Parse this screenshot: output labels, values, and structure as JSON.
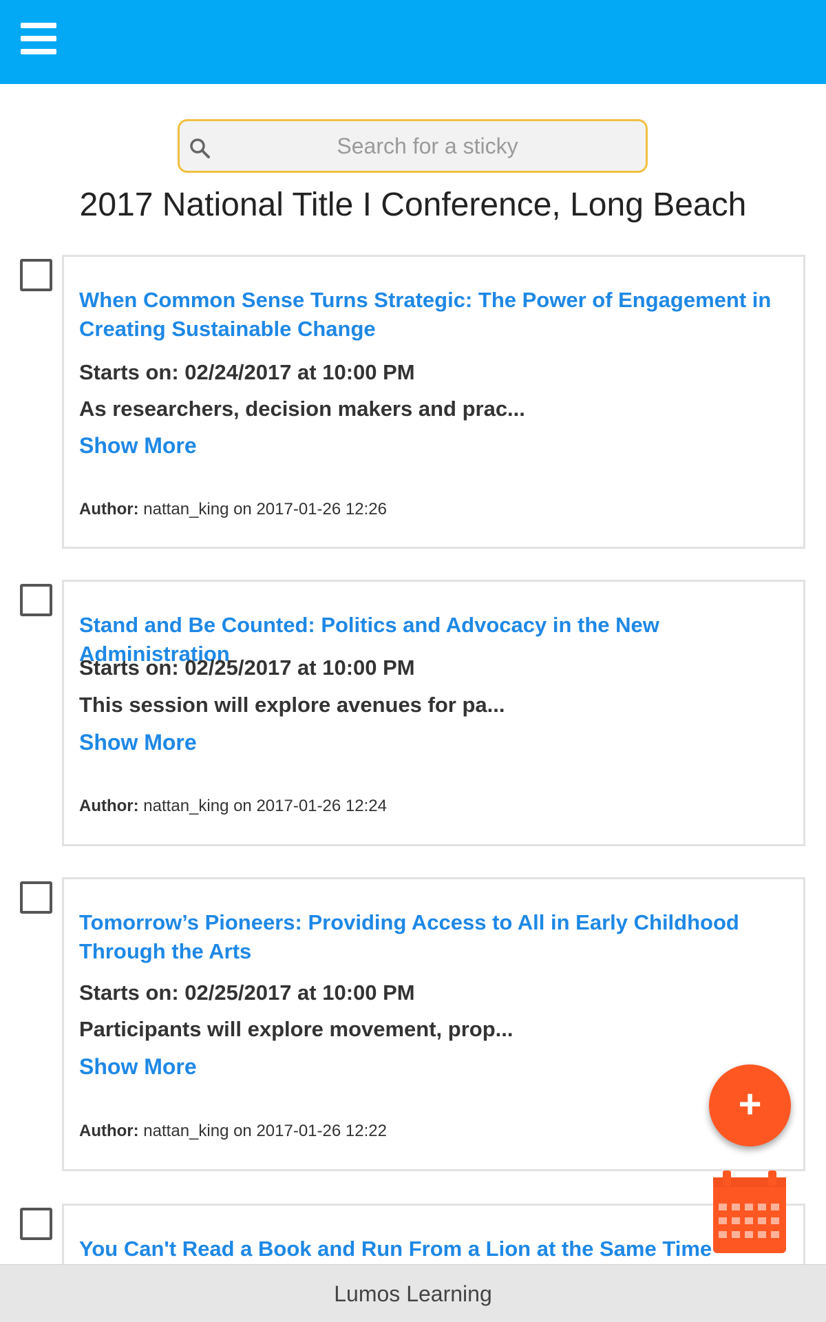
{
  "colors": {
    "app_bar": "#03a9f4",
    "link": "#1e88e5",
    "fab": "#ff5722",
    "search_border": "#f0c040"
  },
  "header": {
    "menu_icon": "hamburger-menu-icon"
  },
  "search": {
    "placeholder": "Search for a sticky",
    "value": ""
  },
  "page_title": "2017 National Title I Conference, Long Beach",
  "cards": [
    {
      "title": "When Common Sense Turns Strategic: The Power of Engagement in Creating Sustainable Change",
      "starts": "Starts on: 02/24/2017 at 10:00 PM",
      "description": "As researchers, decision makers and prac...",
      "show_more": "Show More",
      "author_label": "Author:",
      "author_text": " nattan_king on 2017-01-26 12:26"
    },
    {
      "title": "Stand and Be Counted: Politics and Advocacy in the New Administration",
      "starts": "Starts on: 02/25/2017 at 10:00 PM",
      "description": "This session will explore avenues for pa...",
      "show_more": "Show More",
      "author_label": "Author:",
      "author_text": " nattan_king on 2017-01-26 12:24"
    },
    {
      "title": "Tomorrow’s Pioneers: Providing Access to All in Early Childhood Through the Arts",
      "starts": "Starts on: 02/25/2017 at 10:00 PM",
      "description": "Participants will explore movement, prop...",
      "show_more": "Show More",
      "author_label": "Author:",
      "author_text": " nattan_king on 2017-01-26 12:22"
    },
    {
      "title": "You Can't Read a Book and Run From a Lion at the Same Time"
    }
  ],
  "fab": {
    "add_symbol": "+",
    "add_icon": "plus-icon",
    "calendar_icon": "calendar-icon"
  },
  "footer": {
    "text": "Lumos Learning"
  }
}
